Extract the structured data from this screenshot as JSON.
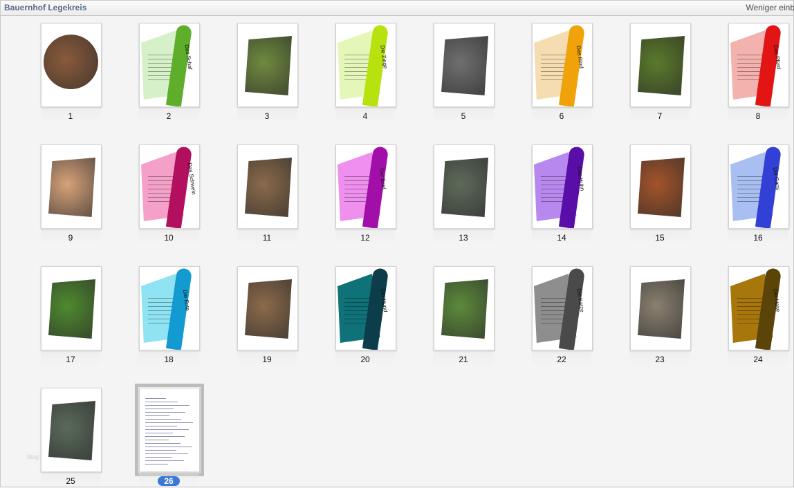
{
  "window": {
    "title": "Bauernhof Legekreis",
    "less_button": "Weniger einb"
  },
  "watermark": "blog",
  "pages": [
    {
      "n": "1",
      "kind": "photo-round",
      "color": "#8a5a3a"
    },
    {
      "n": "2",
      "kind": "arc",
      "label": "Das Schaf",
      "band": "#5fae2b",
      "fill": "#d6f1c9"
    },
    {
      "n": "3",
      "kind": "photo",
      "color": "#6f8a3e"
    },
    {
      "n": "4",
      "kind": "arc",
      "label": "Die Ziege",
      "band": "#b7e20f",
      "fill": "#e5f7b8"
    },
    {
      "n": "5",
      "kind": "photo",
      "color": "#6f6f6f"
    },
    {
      "n": "6",
      "kind": "arc",
      "label": "Das Rind",
      "band": "#f0a20a",
      "fill": "#f6ddb1"
    },
    {
      "n": "7",
      "kind": "photo",
      "color": "#5a7a2a"
    },
    {
      "n": "8",
      "kind": "arc",
      "label": "Das Pferd",
      "band": "#e21414",
      "fill": "#f3b2ad"
    },
    {
      "n": "9",
      "kind": "photo",
      "color": "#d7a27a"
    },
    {
      "n": "10",
      "kind": "arc",
      "label": "Das Schwein",
      "band": "#b2105e",
      "fill": "#f5a0c8"
    },
    {
      "n": "11",
      "kind": "photo",
      "color": "#8a6a4a"
    },
    {
      "n": "12",
      "kind": "arc",
      "label": "Der Esel",
      "band": "#a20fa8",
      "fill": "#ef8fee"
    },
    {
      "n": "13",
      "kind": "photo",
      "color": "#5e6a5a"
    },
    {
      "n": "14",
      "kind": "arc",
      "label": "Das Huhn",
      "band": "#5a0ea8",
      "fill": "#b789ef"
    },
    {
      "n": "15",
      "kind": "photo",
      "color": "#a4532a"
    },
    {
      "n": "16",
      "kind": "arc",
      "label": "Die Gans",
      "band": "#3340d6",
      "fill": "#a9bff1"
    },
    {
      "n": "17",
      "kind": "photo",
      "color": "#4e8a2e"
    },
    {
      "n": "18",
      "kind": "arc",
      "label": "Die Ente",
      "band": "#139ad1",
      "fill": "#8fe3f3"
    },
    {
      "n": "19",
      "kind": "photo",
      "color": "#8c6a4a"
    },
    {
      "n": "20",
      "kind": "arc",
      "label": "Der Hund",
      "band": "#0d3d4a",
      "fill": "#0e7278"
    },
    {
      "n": "21",
      "kind": "photo",
      "color": "#5c8a3a"
    },
    {
      "n": "22",
      "kind": "arc",
      "label": "Die Katze",
      "band": "#4a4a4a",
      "fill": "#8e8e8e"
    },
    {
      "n": "23",
      "kind": "photo",
      "color": "#8a8070"
    },
    {
      "n": "24",
      "kind": "arc",
      "label": "Der Hase",
      "band": "#5a4408",
      "fill": "#a7770c"
    },
    {
      "n": "25",
      "kind": "photo",
      "color": "#5a6a5a"
    },
    {
      "n": "26",
      "kind": "doc",
      "selected": true
    }
  ]
}
